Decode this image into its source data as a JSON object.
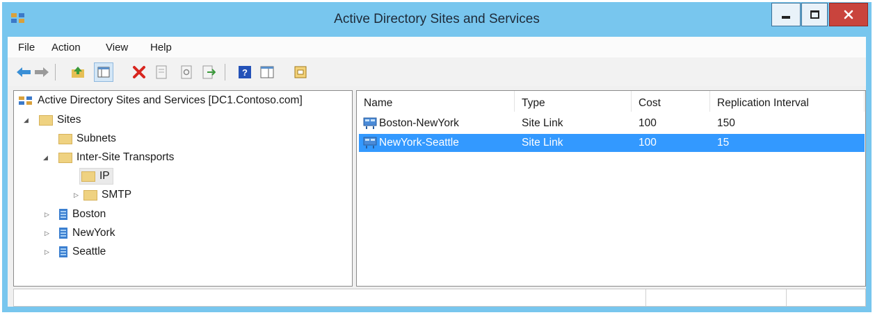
{
  "window": {
    "title": "Active Directory Sites and Services"
  },
  "menubar": {
    "items": [
      "File",
      "Action",
      "View",
      "Help"
    ]
  },
  "toolbar": {
    "icons": [
      "back-arrow-icon",
      "forward-arrow-icon",
      "up-folder-icon",
      "show-hide-console-tree-icon",
      "delete-icon",
      "properties-icon",
      "refresh-icon",
      "export-list-icon",
      "help-icon",
      "action-pane-icon",
      "new-object-icon"
    ]
  },
  "tree": {
    "root": "Active Directory Sites and Services [DC1.Contoso.com]",
    "sites": "Sites",
    "subnets": "Subnets",
    "inter_site": "Inter-Site Transports",
    "ip": "IP",
    "smtp": "SMTP",
    "boston": "Boston",
    "newyork": "NewYork",
    "seattle": "Seattle"
  },
  "list": {
    "columns": {
      "name": "Name",
      "type": "Type",
      "cost": "Cost",
      "interval": "Replication Interval"
    },
    "rows": [
      {
        "name": "Boston-NewYork",
        "type": "Site Link",
        "cost": "100",
        "interval": "150",
        "selected": false
      },
      {
        "name": "NewYork-Seattle",
        "type": "Site Link",
        "cost": "100",
        "interval": "15",
        "selected": true
      }
    ]
  },
  "colors": {
    "title_bar": "#78c6ee",
    "selection": "#3399ff",
    "close_button": "#c9443d"
  }
}
